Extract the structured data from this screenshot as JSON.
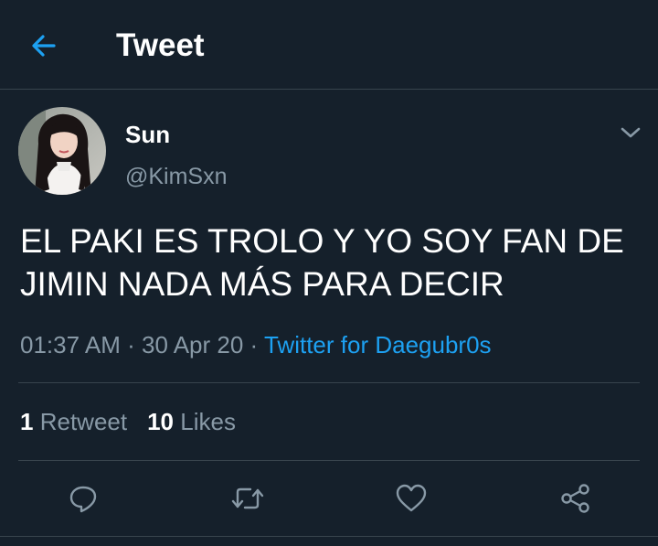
{
  "header": {
    "title": "Tweet",
    "back_icon": "arrow-left-icon",
    "accent": "#1da1f2"
  },
  "tweet": {
    "author": {
      "name": "Sun",
      "handle": "@KimSxn"
    },
    "text": "EL PAKI ES TROLO Y YO SOY FAN DE JIMIN NADA MÁS PARA DECIR",
    "time": "01:37 AM",
    "date": "30 Apr 20",
    "source": "Twitter for Daegubr0s",
    "separator": "·"
  },
  "stats": {
    "retweet_count": "1",
    "retweet_label": "Retweet",
    "like_count": "10",
    "like_label": "Likes"
  },
  "actions": [
    "reply-icon",
    "retweet-icon",
    "like-icon",
    "share-icon"
  ],
  "colors": {
    "background": "#15202b",
    "border": "#38444d",
    "secondary_text": "#8899a6",
    "link": "#1da1f2"
  }
}
